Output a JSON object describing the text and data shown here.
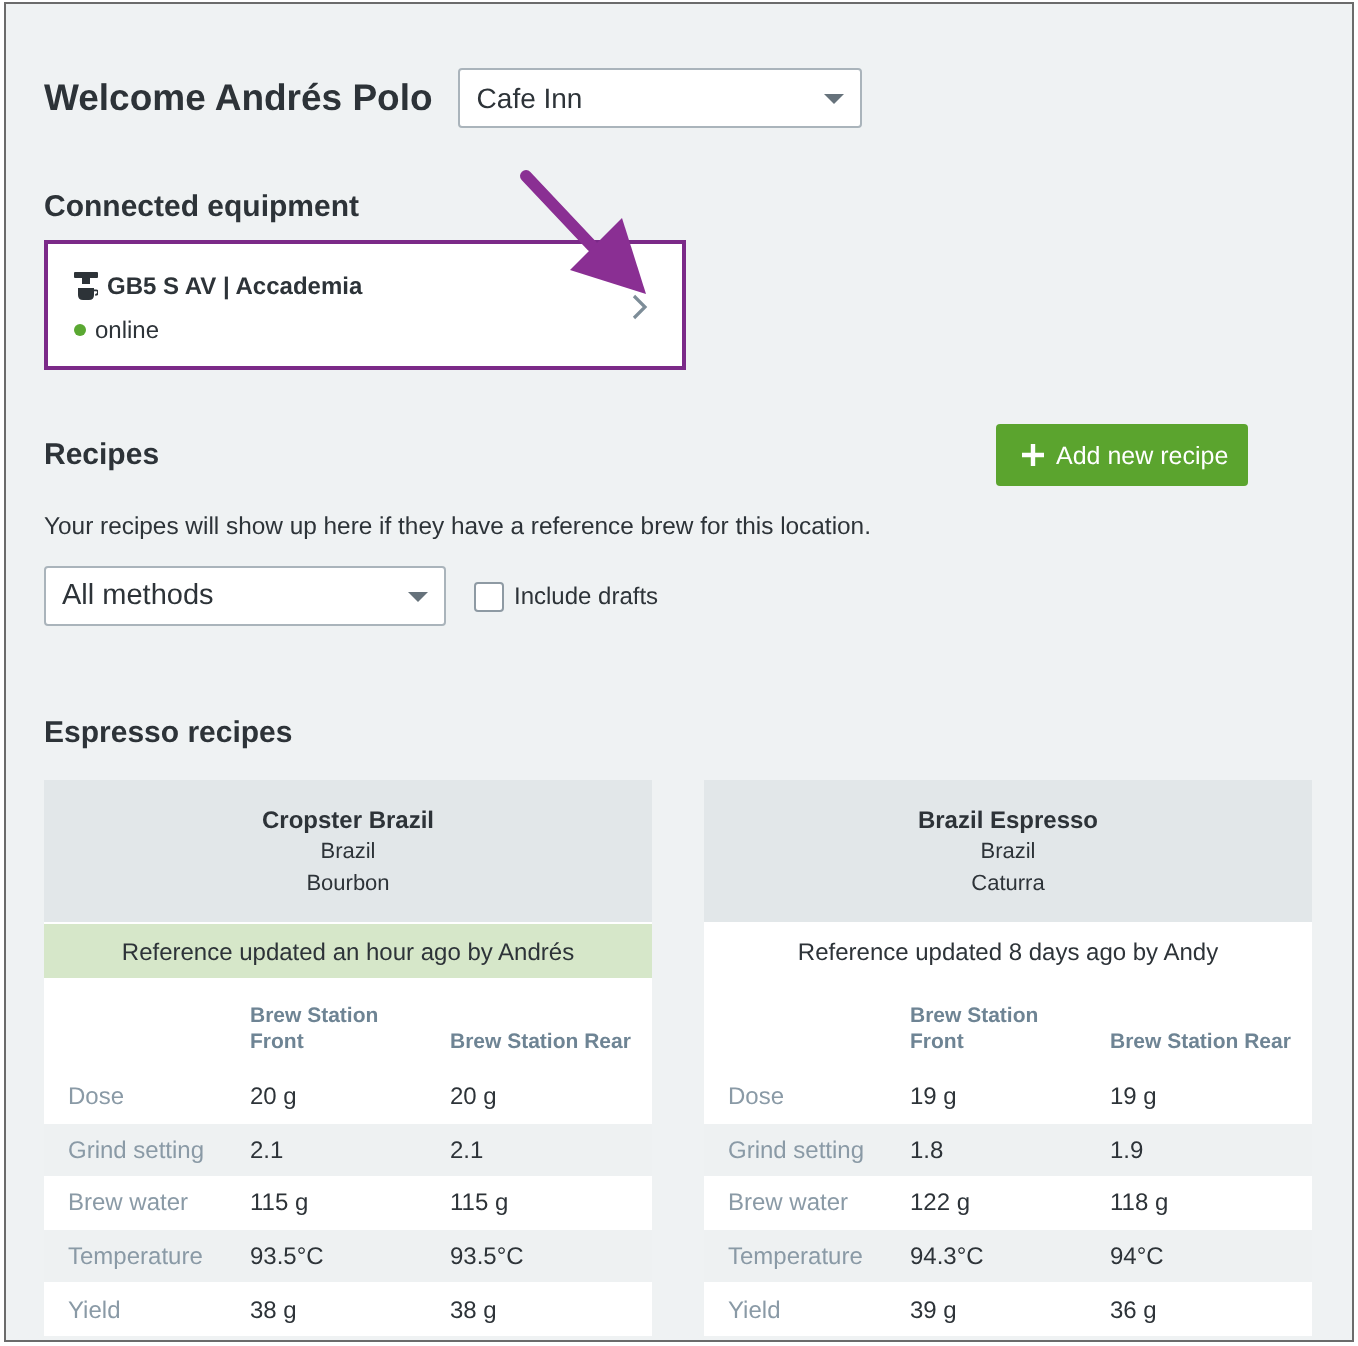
{
  "header": {
    "title": "Welcome Andrés Polo",
    "location_select": {
      "value": "Cafe Inn"
    }
  },
  "equipment": {
    "heading": "Connected equipment",
    "items": [
      {
        "name": "GB5 S AV | Accademia",
        "status": "online",
        "online": true,
        "highlighted": true
      }
    ]
  },
  "recipes": {
    "heading": "Recipes",
    "add_button": {
      "label": "Add new recipe"
    },
    "description": "Your recipes will show up here if they have a reference brew for this location.",
    "method_select": {
      "value": "All methods"
    },
    "include_drafts": {
      "label": "Include drafts",
      "checked": false
    }
  },
  "espresso": {
    "heading": "Espresso recipes",
    "cards": [
      {
        "title": "Cropster Brazil",
        "origin": "Brazil",
        "variety": "Bourbon",
        "reference": {
          "text": "Reference updated an hour ago by Andrés",
          "highlighted": true
        },
        "columns": [
          "Brew Station Front",
          "Brew Station Rear"
        ],
        "rows": [
          {
            "label": "Dose",
            "values": [
              "20 g",
              "20 g"
            ]
          },
          {
            "label": "Grind setting",
            "values": [
              "2.1",
              "2.1"
            ]
          },
          {
            "label": "Brew water",
            "values": [
              "115 g",
              "115 g"
            ]
          },
          {
            "label": "Temperature",
            "values": [
              "93.5°C",
              "93.5°C"
            ]
          },
          {
            "label": "Yield",
            "values": [
              "38 g",
              "38 g"
            ]
          }
        ]
      },
      {
        "title": "Brazil Espresso",
        "origin": "Brazil",
        "variety": "Caturra",
        "reference": {
          "text": "Reference updated 8 days ago by Andy",
          "highlighted": false
        },
        "columns": [
          "Brew Station Front",
          "Brew Station Rear"
        ],
        "rows": [
          {
            "label": "Dose",
            "values": [
              "19 g",
              "19 g"
            ]
          },
          {
            "label": "Grind setting",
            "values": [
              "1.8",
              "1.9"
            ]
          },
          {
            "label": "Brew water",
            "values": [
              "122 g",
              "118 g"
            ]
          },
          {
            "label": "Temperature",
            "values": [
              "94.3°C",
              "94°C"
            ]
          },
          {
            "label": "Yield",
            "values": [
              "39 g",
              "36 g"
            ]
          }
        ]
      }
    ]
  }
}
